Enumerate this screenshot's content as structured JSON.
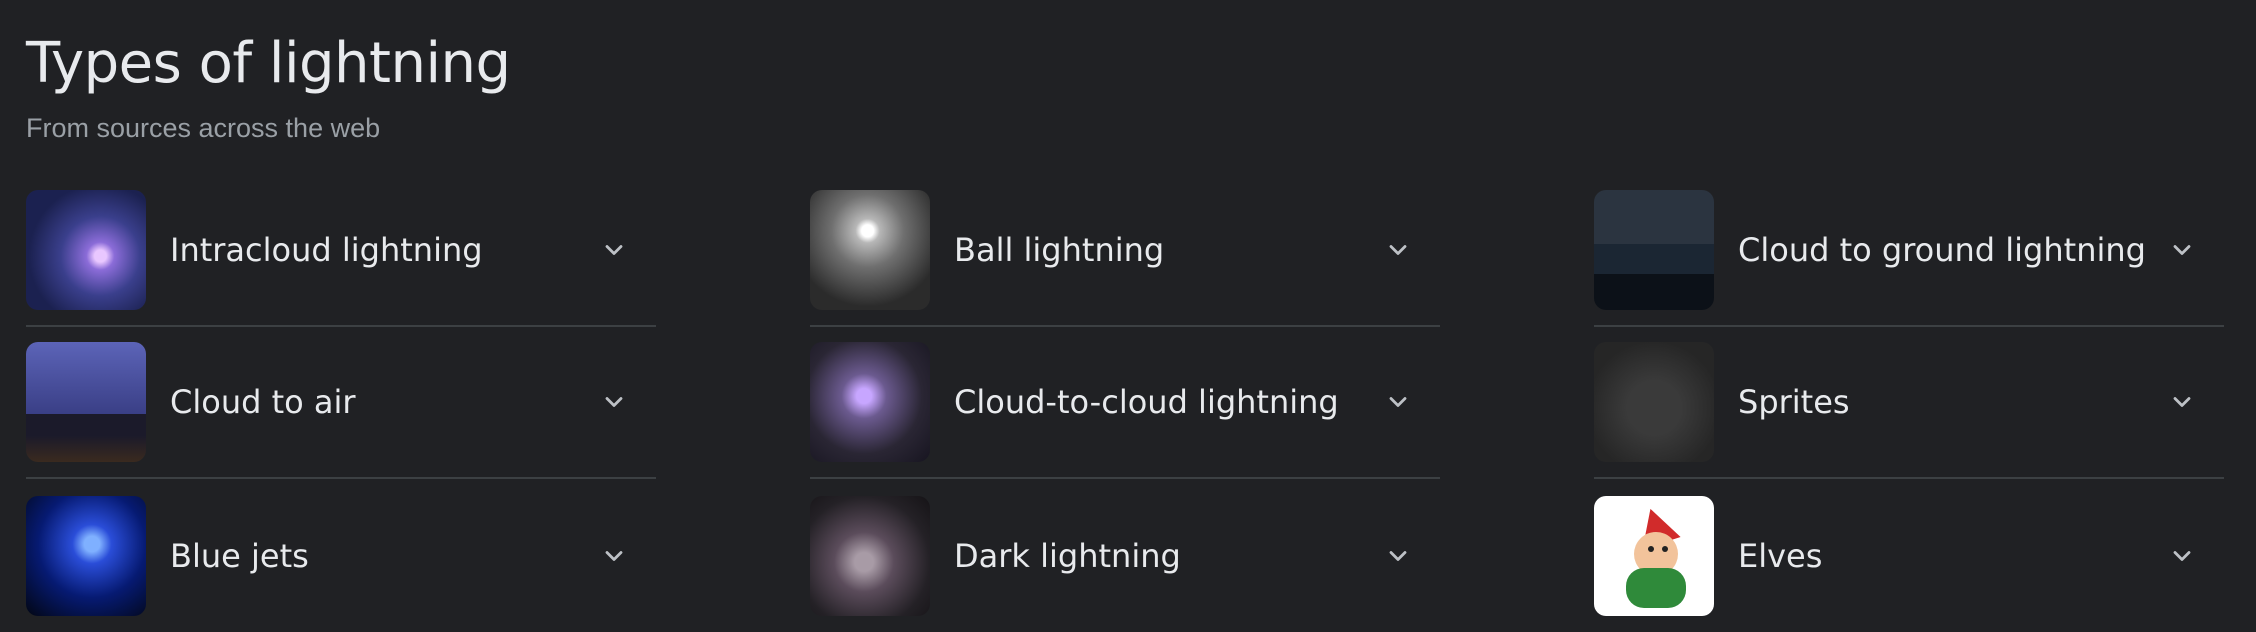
{
  "header": {
    "title": "Types of lightning",
    "subtitle": "From sources across the web"
  },
  "items": [
    {
      "label": "Intracloud lightning",
      "thumb": "thumbnail-intracloud",
      "column": 1
    },
    {
      "label": "Cloud to air",
      "thumb": "thumbnail-cloud-to-air",
      "column": 1
    },
    {
      "label": "Blue jets",
      "thumb": "thumbnail-blue-jets",
      "column": 1
    },
    {
      "label": "Ball lightning",
      "thumb": "thumbnail-ball-lightning",
      "column": 2
    },
    {
      "label": "Cloud-to-cloud lightning",
      "thumb": "thumbnail-cloud-to-cloud",
      "column": 2
    },
    {
      "label": "Dark lightning",
      "thumb": "thumbnail-dark-lightning",
      "column": 2
    },
    {
      "label": "Cloud to ground lightning",
      "thumb": "thumbnail-cloud-to-ground",
      "column": 3
    },
    {
      "label": "Sprites",
      "thumb": "thumbnail-sprites",
      "column": 3
    },
    {
      "label": "Elves",
      "thumb": "thumbnail-elves",
      "column": 3
    }
  ],
  "icons": {
    "expand": "chevron-down-icon"
  },
  "colors": {
    "background": "#202124",
    "text": "#e8eaed",
    "muted": "#9aa0a6",
    "divider": "#3c4043"
  }
}
